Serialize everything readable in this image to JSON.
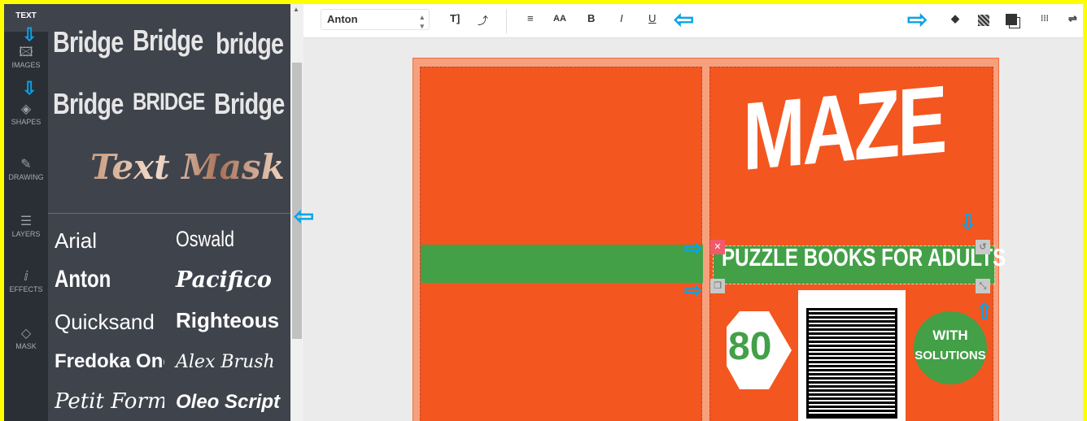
{
  "sidebar": {
    "top_label": "TEXT",
    "items": [
      {
        "label": "IMAGES",
        "icon": "image-icon"
      },
      {
        "label": "SHAPES",
        "icon": "diamond-icon"
      },
      {
        "label": "DRAWING",
        "icon": "pencil-icon"
      },
      {
        "label": "LAYERS",
        "icon": "layers-icon"
      },
      {
        "label": "EFFECTS",
        "icon": "effects-icon"
      },
      {
        "label": "MASK",
        "icon": "mask-icon"
      }
    ]
  },
  "panel": {
    "text_styles": [
      "Bridge",
      "Bridge",
      "bridge",
      "Bridge",
      "BRIDGE",
      "Bridge"
    ],
    "text_mask": "Text Mask",
    "fonts": [
      "Arial",
      "Oswald",
      "Anton",
      "Pacifico",
      "Quicksand",
      "Righteous",
      "Fredoka One",
      "Alex Brush",
      "Petit Formal",
      "Oleo Script"
    ]
  },
  "toolbar": {
    "font_value": "Anton",
    "align_icon": "≡",
    "size_label": "AA",
    "bold": "B",
    "italic": "I",
    "underline": "U"
  },
  "cover": {
    "title": "MAZE",
    "subtitle": "PUZZLE BOOKS FOR ADULTS",
    "count": "80",
    "badge": [
      "WITH",
      "SOLUTIONS"
    ]
  },
  "colors": {
    "orange": "#f4561f",
    "green": "#43a047",
    "annotation": "#0aa3e8",
    "frame": "#ffff00"
  }
}
